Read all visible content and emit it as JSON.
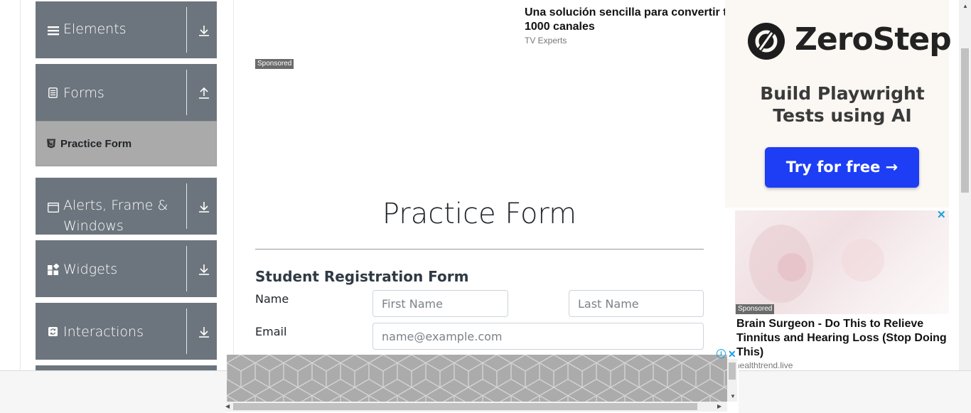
{
  "sidebar": {
    "groups": [
      {
        "label": "Elements",
        "icon": "hamburger-icon",
        "chevron": "download-arrow-icon"
      },
      {
        "label": "Forms",
        "icon": "document-icon",
        "chevron": "upload-arrow-icon"
      },
      {
        "label": "Alerts, Frame & Windows",
        "icon": "window-icon",
        "chevron": "download-arrow-icon"
      },
      {
        "label": "Widgets",
        "icon": "widgets-icon",
        "chevron": "download-arrow-icon"
      },
      {
        "label": "Interactions",
        "icon": "interactions-icon",
        "chevron": "download-arrow-icon"
      }
    ],
    "active_item": {
      "label": "Practice Form",
      "icon": "html5-icon"
    }
  },
  "top_ad": {
    "headline": "Una solución sencilla para convertir t 1000 canales",
    "source": "TV Experts",
    "sponsored": "Sponsored"
  },
  "main": {
    "title": "Practice Form",
    "form_heading": "Student Registration Form",
    "name_label": "Name",
    "first_name_placeholder": "First Name",
    "last_name_placeholder": "Last Name",
    "email_label": "Email",
    "email_placeholder": "name@example.com"
  },
  "right_ad": {
    "brand": "ZeroStep",
    "tagline": "Build Playwright Tests using AI",
    "cta": "Try for free →",
    "close": "✕"
  },
  "right_ad2": {
    "sponsored": "Sponsored",
    "headline": "Brain Surgeon - Do This to Relieve Tinnitus and Hearing Loss (Stop Doing This)",
    "source": "healthtrend.live"
  },
  "banner": {
    "close": "✕",
    "info": "i"
  },
  "colors": {
    "sidebar_group": "#6c757d",
    "sidebar_active": "#aaaaaa",
    "cta_blue": "#1d3ef4",
    "ad_close": "#1a9fe0"
  }
}
